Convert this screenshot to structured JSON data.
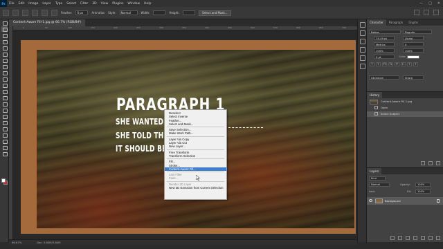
{
  "menubar": {
    "logo": "Ps",
    "items": [
      "File",
      "Edit",
      "Image",
      "Layer",
      "Type",
      "Select",
      "Filter",
      "3D",
      "View",
      "Plugins",
      "Window",
      "Help"
    ],
    "window_controls": [
      "—",
      "□",
      "✕"
    ]
  },
  "options": {
    "feather_label": "Feather:",
    "feather_value": "0 px",
    "antialias_label": "Anti-alias",
    "style_label": "Style:",
    "style_value": "Normal",
    "width_label": "Width:",
    "height_label": "Height:",
    "select_mask_label": "Select and Mask..."
  },
  "document": {
    "tab_title": "Content-Aware Fill-1.jpg @ 66.7% (RGB/8#)",
    "ruler_ticks": [
      "0",
      "50",
      "100",
      "150",
      "200",
      "250",
      "300",
      "350",
      "400",
      "450",
      "500",
      "550",
      "600",
      "650",
      "700"
    ],
    "headline": "PARAGRAPH 1",
    "body_lines": [
      "SHE WANTED I          AT'S WHAT",
      "SHE TOLD THE",
      "IT SHOULD BE                      OLORS, TOO."
    ]
  },
  "context_menu": {
    "items": [
      {
        "label": "Deselect",
        "state": "normal"
      },
      {
        "label": "Select Inverse",
        "state": "normal"
      },
      {
        "label": "Feather...",
        "state": "normal"
      },
      {
        "label": "Select and Mask...",
        "state": "normal"
      },
      {
        "sep": true
      },
      {
        "label": "Save Selection...",
        "state": "normal"
      },
      {
        "label": "Make Work Path...",
        "state": "normal"
      },
      {
        "sep": true
      },
      {
        "label": "Layer Via Copy",
        "state": "normal"
      },
      {
        "label": "Layer Via Cut",
        "state": "normal"
      },
      {
        "label": "New Layer...",
        "state": "normal"
      },
      {
        "sep": true
      },
      {
        "label": "Free Transform",
        "state": "normal"
      },
      {
        "label": "Transform Selection",
        "state": "normal"
      },
      {
        "sep": true
      },
      {
        "label": "Fill...",
        "state": "normal"
      },
      {
        "label": "Stroke...",
        "state": "normal"
      },
      {
        "label": "Content-Aware Fill...",
        "state": "selected"
      },
      {
        "sep": true
      },
      {
        "label": "Last Filter",
        "state": "disabled"
      },
      {
        "label": "Fade...",
        "state": "disabled"
      },
      {
        "sep": true
      },
      {
        "label": "Render 3D Layer",
        "state": "disabled"
      },
      {
        "label": "New 3D Extrusion from Current Selection",
        "state": "normal"
      }
    ]
  },
  "status": {
    "zoom": "66.67%",
    "doc_info": "Doc: 3.84M/3.84M"
  },
  "character_panel": {
    "tabs": [
      "Character",
      "Paragraph",
      "Glyphs"
    ],
    "font_family": "Bebas",
    "font_style": "Regular",
    "size": "74.49 pt",
    "leading": "(Auto)",
    "kerning": "Metrics",
    "tracking": "0",
    "vscale": "100%",
    "hscale": "100%",
    "baseline": "0 pt",
    "color_label": "Color:",
    "color": "#ffffff",
    "language": "Ukrainian",
    "antialias": "Sharp",
    "style_buttons": [
      "T",
      "T",
      "TT",
      "Tt",
      "T¹",
      "T₁",
      "T",
      "T"
    ]
  },
  "history_panel": {
    "title": "History",
    "snapshot": "Content-Aware Fill-1.jpg",
    "items": [
      "Open",
      "Select Subject"
    ]
  },
  "layers_panel": {
    "title": "Layers",
    "kind_label": "Kind",
    "blend_mode": "Normal",
    "opacity_label": "Opacity:",
    "opacity": "100%",
    "fill_label": "Fill:",
    "fill": "100%",
    "lock_label": "Lock:",
    "layer_name": "Background"
  }
}
